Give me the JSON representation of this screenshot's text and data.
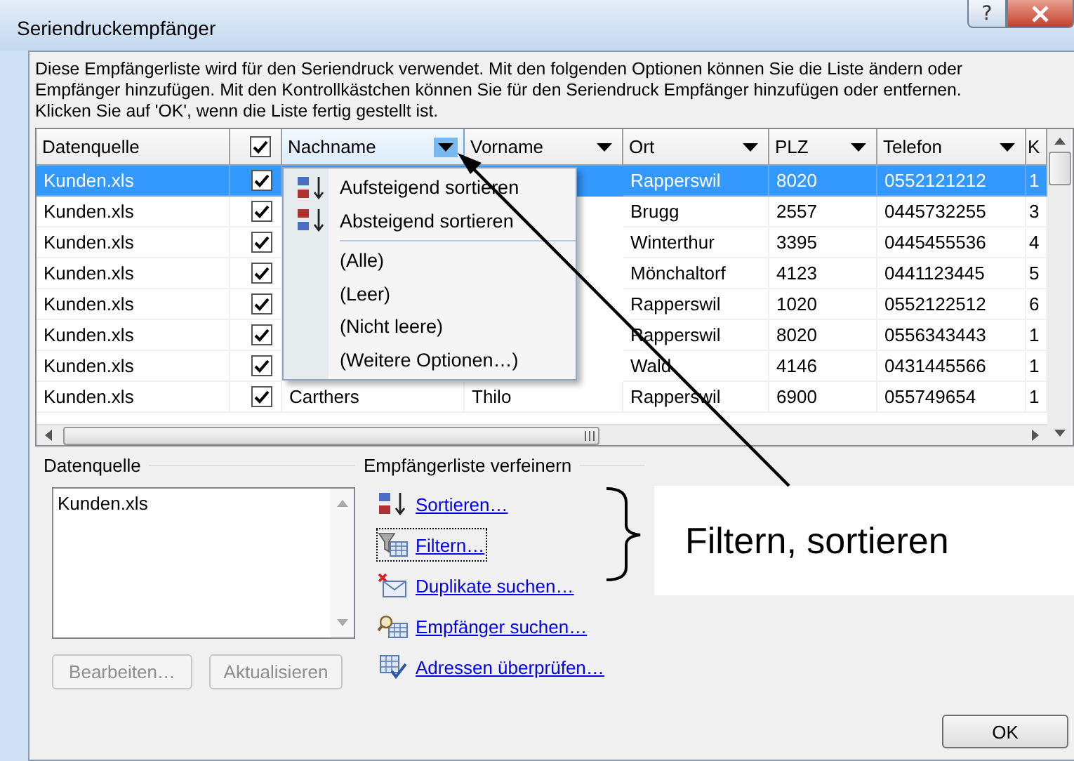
{
  "window": {
    "title": "Seriendruckempfänger",
    "help_button": "?"
  },
  "description": [
    "Diese Empfängerliste wird für den Seriendruck verwendet. Mit den folgenden Optionen können Sie die Liste ändern oder",
    "Empfänger hinzufügen. Mit den Kontrollkästchen können Sie für den Seriendruck Empfänger hinzufügen oder entfernen.",
    "Klicken Sie auf 'OK', wenn die Liste fertig gestellt ist."
  ],
  "table": {
    "columns": [
      {
        "kind": "text",
        "label": "Datenquelle"
      },
      {
        "kind": "checkbox",
        "checked": true
      },
      {
        "kind": "dropdown",
        "label": "Nachname",
        "open": true
      },
      {
        "kind": "dropdown",
        "label": "Vorname",
        "open": false
      },
      {
        "kind": "dropdown",
        "label": "Ort",
        "open": false
      },
      {
        "kind": "dropdown",
        "label": "PLZ",
        "open": false
      },
      {
        "kind": "dropdown",
        "label": "Telefon",
        "open": false
      },
      {
        "kind": "text",
        "label": "K"
      }
    ],
    "rows": [
      {
        "selected": true,
        "datenquelle": "Kunden.xls",
        "checked": true,
        "ort": "Rapperswil",
        "plz": "8020",
        "telefon": "0552121212",
        "column_8": "1"
      },
      {
        "selected": false,
        "datenquelle": "Kunden.xls",
        "checked": true,
        "ort": "Brugg",
        "plz": "2557",
        "telefon": "0445732255",
        "column_8": "3"
      },
      {
        "selected": false,
        "datenquelle": "Kunden.xls",
        "checked": true,
        "ort": "Winterthur",
        "plz": "3395",
        "telefon": "0445455536",
        "column_8": "4"
      },
      {
        "selected": false,
        "datenquelle": "Kunden.xls",
        "checked": true,
        "ort": "Mönchaltorf",
        "plz": "4123",
        "telefon": "0441123445",
        "column_8": "5"
      },
      {
        "selected": false,
        "datenquelle": "Kunden.xls",
        "checked": true,
        "ort": "Rapperswil",
        "plz": "1020",
        "telefon": "0552122512",
        "column_8": "6"
      },
      {
        "selected": false,
        "datenquelle": "Kunden.xls",
        "checked": true,
        "ort": "Rapperswil",
        "plz": "8020",
        "telefon": "0556343443",
        "column_8": "1"
      },
      {
        "selected": false,
        "datenquelle": "Kunden.xls",
        "checked": true,
        "ort": "Wald",
        "plz": "4146",
        "telefon": "0431445566",
        "column_8": "1"
      },
      {
        "selected": false,
        "datenquelle": "Kunden.xls",
        "checked": true,
        "nachname": "Carthers",
        "vorname": "Thilo",
        "ort": "Rapperswil",
        "plz": "6900",
        "telefon": "055749654",
        "column_8": "1"
      }
    ]
  },
  "column_menu": {
    "items": [
      {
        "kind": "sort_ascending",
        "label": "Aufsteigend sortieren"
      },
      {
        "kind": "sort_descending",
        "label": "Absteigend sortieren"
      },
      {
        "kind": "separator"
      },
      {
        "kind": "filter",
        "label": "(Alle)"
      },
      {
        "kind": "filter",
        "label": "(Leer)"
      },
      {
        "kind": "filter",
        "label": "(Nicht leere)"
      },
      {
        "kind": "filter",
        "label": "(Weitere Optionen…)"
      }
    ]
  },
  "data_source": {
    "label": "Datenquelle",
    "items": [
      "Kunden.xls"
    ],
    "buttons": [
      {
        "label": "Bearbeiten…",
        "disabled": true
      },
      {
        "label": "Aktualisieren",
        "disabled": true
      }
    ]
  },
  "refine": {
    "label": "Empfängerliste verfeinern",
    "links": [
      {
        "kind": "sort",
        "label": "Sortieren…",
        "focused": false
      },
      {
        "kind": "filter",
        "label": "Filtern…",
        "focused": true
      },
      {
        "kind": "duplicates",
        "label": "Duplikate suchen…",
        "focused": false
      },
      {
        "kind": "find",
        "label": "Empfänger suchen…",
        "focused": false
      },
      {
        "kind": "validate",
        "label": "Adressen überprüfen…",
        "focused": false
      }
    ]
  },
  "callout": {
    "text": "Filtern, sortieren"
  },
  "ok_button": "OK"
}
